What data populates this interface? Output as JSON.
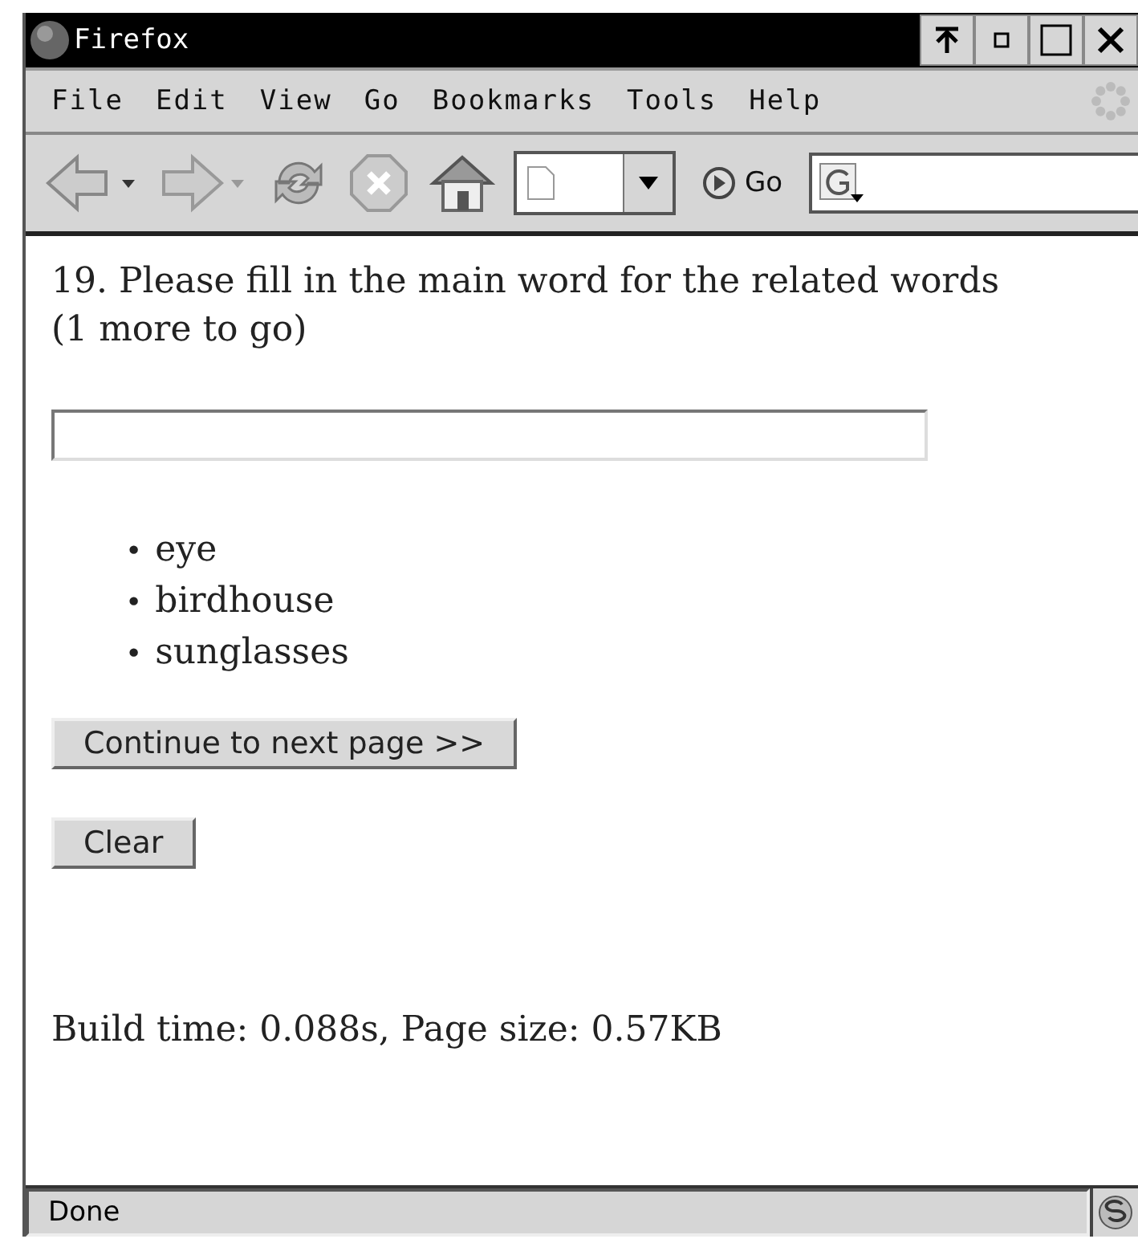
{
  "window": {
    "title": "Firefox"
  },
  "menu": [
    "File",
    "Edit",
    "View",
    "Go",
    "Bookmarks",
    "Tools",
    "Help"
  ],
  "toolbar": {
    "go_label": "Go"
  },
  "page": {
    "question": "19. Please fill in the main word for the related words (1 more to go)",
    "words": [
      {
        "bullet": "•",
        "text": "eye"
      },
      {
        "bullet": "•",
        "text": "birdhouse"
      },
      {
        "bullet": "•",
        "text": "sunglasses"
      }
    ],
    "buttons": [
      "Continue to next page >>",
      "Clear"
    ],
    "footer": "Build time: 0.088s, Page size: 0.57KB"
  },
  "status_bar": {
    "text": "Done"
  }
}
